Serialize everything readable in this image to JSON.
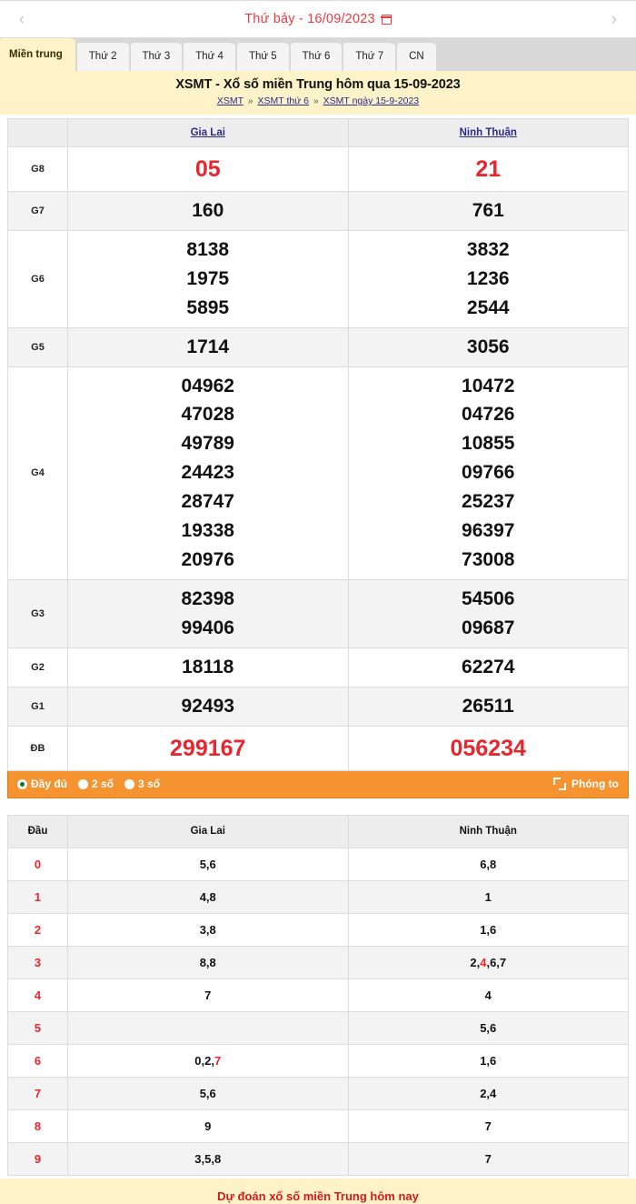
{
  "datebar": {
    "prev_label": "‹",
    "next_label": "›",
    "date_text": "Thứ bảy -  16/09/2023",
    "calendar_icon": "calendar-icon"
  },
  "tabs": [
    {
      "label": "Miền trung",
      "active": true
    },
    {
      "label": "Thứ 2",
      "active": false
    },
    {
      "label": "Thứ 3",
      "active": false
    },
    {
      "label": "Thứ 4",
      "active": false
    },
    {
      "label": "Thứ 5",
      "active": false
    },
    {
      "label": "Thứ 6",
      "active": false
    },
    {
      "label": "Thứ 7",
      "active": false
    },
    {
      "label": "CN",
      "active": false
    }
  ],
  "title": {
    "heading": "XSMT - Xổ số miền Trung hôm qua 15-09-2023",
    "crumb1": "XSMT",
    "crumb2": "XSMT thứ 6",
    "crumb3": "XSMT ngày 15-9-2023",
    "separator": "»"
  },
  "results": {
    "columns": [
      "",
      "Gia Lai",
      "Ninh Thuận"
    ],
    "rows": [
      {
        "label": "G8",
        "gialai": "05",
        "ninhthuan": "21",
        "highlight": true,
        "shade": false
      },
      {
        "label": "G7",
        "gialai": "160",
        "ninhthuan": "761",
        "highlight": false,
        "shade": true
      },
      {
        "label": "G6",
        "gialai": "8138\n1975\n5895",
        "ninhthuan": "3832\n1236\n2544",
        "highlight": false,
        "shade": false
      },
      {
        "label": "G5",
        "gialai": "1714",
        "ninhthuan": "3056",
        "highlight": false,
        "shade": true
      },
      {
        "label": "G4",
        "gialai": "04962\n47028\n49789\n24423\n28747\n19338\n20976",
        "ninhthuan": "10472\n04726\n10855\n09766\n25237\n96397\n73008",
        "highlight": false,
        "shade": false
      },
      {
        "label": "G3",
        "gialai": "82398\n99406",
        "ninhthuan": "54506\n09687",
        "highlight": false,
        "shade": true
      },
      {
        "label": "G2",
        "gialai": "18118",
        "ninhthuan": "62274",
        "highlight": false,
        "shade": false
      },
      {
        "label": "G1",
        "gialai": "92493",
        "ninhthuan": "26511",
        "highlight": false,
        "shade": true
      },
      {
        "label": "ĐB",
        "gialai": "299167",
        "ninhthuan": "056234",
        "highlight": true,
        "shade": false
      }
    ]
  },
  "optionbar": {
    "options": [
      {
        "label": "Đầy đủ",
        "selected": true
      },
      {
        "label": "2 số",
        "selected": false
      },
      {
        "label": "3 số",
        "selected": false
      }
    ],
    "zoom_label": "Phóng to",
    "zoom_icon": "expand-icon"
  },
  "dau_table": {
    "columns": [
      "Đầu",
      "Gia Lai",
      "Ninh Thuận"
    ],
    "rows": [
      {
        "digit": "0",
        "gialai": "5,6",
        "ninhthuan": "6,8",
        "shade": false
      },
      {
        "digit": "1",
        "gialai": "4,8",
        "ninhthuan": "1",
        "shade": true
      },
      {
        "digit": "2",
        "gialai": "3,8",
        "ninhthuan": "1,6",
        "shade": false
      },
      {
        "digit": "3",
        "gialai": "8,8",
        "ninhthuan": "2,4,6,7",
        "shade": true
      },
      {
        "digit": "4",
        "gialai": "7",
        "ninhthuan": "4",
        "shade": false
      },
      {
        "digit": "5",
        "gialai": "",
        "ninhthuan": "5,6",
        "shade": true
      },
      {
        "digit": "6",
        "gialai": "0,2,7",
        "ninhthuan": "1,6",
        "shade": false
      },
      {
        "digit": "7",
        "gialai": "5,6",
        "ninhthuan": "2,4",
        "shade": true
      },
      {
        "digit": "8",
        "gialai": "9",
        "ninhthuan": "7",
        "shade": false
      },
      {
        "digit": "9",
        "gialai": "3,5,8",
        "ninhthuan": "7",
        "shade": true
      }
    ]
  },
  "bottom": {
    "teaser": "Dự đoán xổ số miền Trung hôm nay"
  },
  "colors": {
    "red": "#e8262d",
    "orange": "#f59331",
    "cream": "#fdf2c8",
    "link": "#2a2a8c"
  }
}
